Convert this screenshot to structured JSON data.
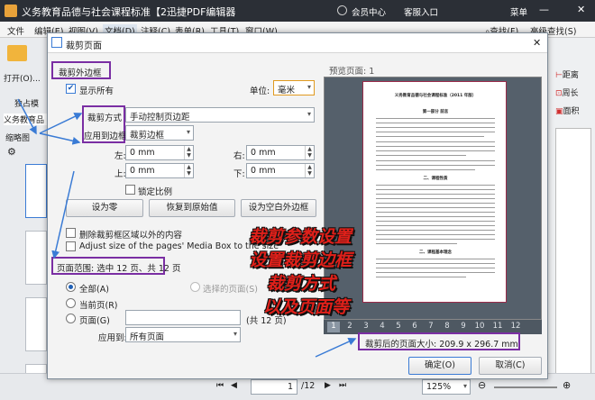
{
  "app": {
    "title": "义务教育品德与社会课程标准【2迅捷PDF编辑器",
    "member": "会员中心",
    "login": "客服入口",
    "menu_btn": "菜单"
  },
  "menubar": [
    "文件",
    "编辑(E)",
    "视图(V)",
    "文档(D)",
    "注释(C)",
    "表单(R)",
    "工具(T)",
    "窗口(W)"
  ],
  "right_tools": {
    "find": "查找(F)",
    "advanced_find": "高级查找(S)",
    "distance": "距离",
    "perimeter": "周长",
    "area": "面积"
  },
  "left_panel": {
    "open": "打开(O)...",
    "standalone": "独占模",
    "tab": "义务教育品",
    "thumbnails": "缩略图"
  },
  "dialog": {
    "title": "裁剪页面",
    "group_crop": "裁剪外边框",
    "show_all": "显示所有",
    "unit_label": "单位:",
    "unit_value": "毫米",
    "crop_method_label": "裁剪方式",
    "crop_method_value": "手动控制页边距",
    "apply_to_box_label": "应用到边框",
    "apply_to_box_value": "裁剪边框",
    "left_label": "左:",
    "left_value": "0 mm",
    "right_label": "右:",
    "right_value": "0 mm",
    "top_label": "上:",
    "top_value": "0 mm",
    "bottom_label": "下:",
    "bottom_value": "0 mm",
    "keep_ratio": "锁定比例",
    "set_zero": "设为零",
    "restore": "恢复到原始值",
    "set_blank": "设为空白外边框",
    "delete_outside": "删除裁剪框区域以外的内容",
    "adjust_media": "Adjust size of the pages' Media Box to the size",
    "page_range": "页面范围: 选中 12 页、共 12 页",
    "all": "全部(A)",
    "selected_pages": "选择的页面(S)",
    "current_page": "当前页(R)",
    "pages": "页面(G)",
    "total": "(共 12 页)",
    "apply_to_label": "应用到:",
    "apply_to_value": "所有页面",
    "preview_label": "预览页面: 1",
    "page_numbers": [
      "1",
      "2",
      "3",
      "4",
      "5",
      "6",
      "7",
      "8",
      "9",
      "10",
      "11",
      "12"
    ],
    "cropped_size": "裁剪后的页面大小: 209.9 x 296.7 mm",
    "ok": "确定(O)",
    "cancel": "取消(C)"
  },
  "paper": {
    "title": "义务教育品德与社会课程标准（2011 年版）",
    "part1": "第一部分 前言",
    "part2": "二、课程性质",
    "part3": "二、课程基本理念"
  },
  "overlay": [
    "裁剪参数设置",
    "设置裁剪边框",
    "裁剪方式",
    "以及页面等"
  ],
  "status": {
    "page": "1",
    "page_total": "/12",
    "zoom": "125%"
  },
  "colors": {
    "annotation": "#7a2ea3",
    "overlay_text": "#e0201a",
    "titlebar": "#2b2f36"
  }
}
